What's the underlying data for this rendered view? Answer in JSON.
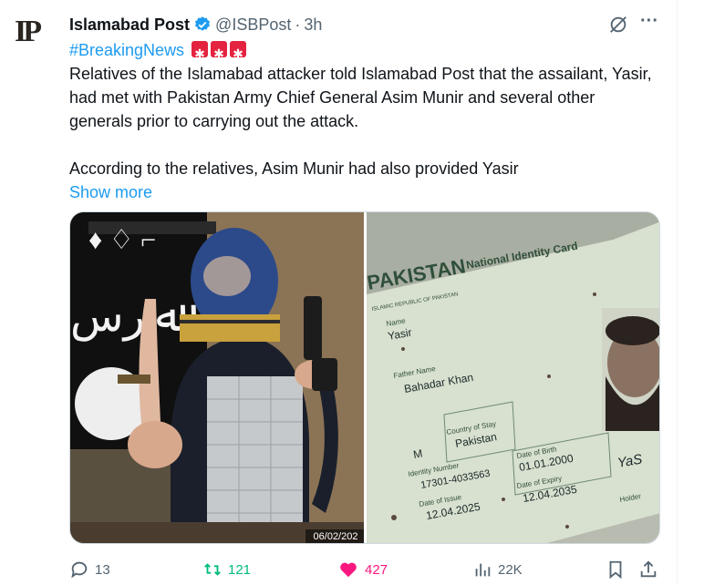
{
  "tweet": {
    "avatar_text": "IP",
    "author_name": "Islamabad Post",
    "handle": "@ISBPost",
    "separator": "·",
    "time": "3h",
    "hashtag": "#BreakingNews",
    "paragraph1": "Relatives of the Islamabad attacker told Islamabad Post that the assailant, Yasir, had met with Pakistan Army Chief General Asim Munir and several other generals prior to carrying out the attack.",
    "paragraph2": "According to the relatives, Asim Munir had also provided Yasir",
    "show_more": "Show more"
  },
  "media": {
    "photo1_stamp": "06/02/202",
    "card": {
      "country": "PAKISTAN",
      "title": "National Identity Card",
      "subtitle": "ISLAMIC REPUBLIC OF PAKISTAN",
      "name_label": "Name",
      "name": "Yasir",
      "father_label": "Father Name",
      "father": "Bahadar Khan",
      "gender": "M",
      "country_label": "Country of Stay",
      "country_stay": "Pakistan",
      "id_label": "Identity Number",
      "id_number": "17301-4033563",
      "dob_label": "Date of Birth",
      "dob": "01.01.2000",
      "issue_label": "Date of Issue",
      "issue": "12.04.2025",
      "expiry_label": "Date of Expiry",
      "expiry": "12.04.2035",
      "holder_label": "Holder",
      "sig": "YaS"
    }
  },
  "actions": {
    "replies": "13",
    "reposts": "121",
    "likes": "427",
    "views": "22K"
  },
  "colors": {
    "accent": "#1d9bf0",
    "repost": "#00ba7c",
    "like": "#f91880",
    "muted": "#536471"
  }
}
